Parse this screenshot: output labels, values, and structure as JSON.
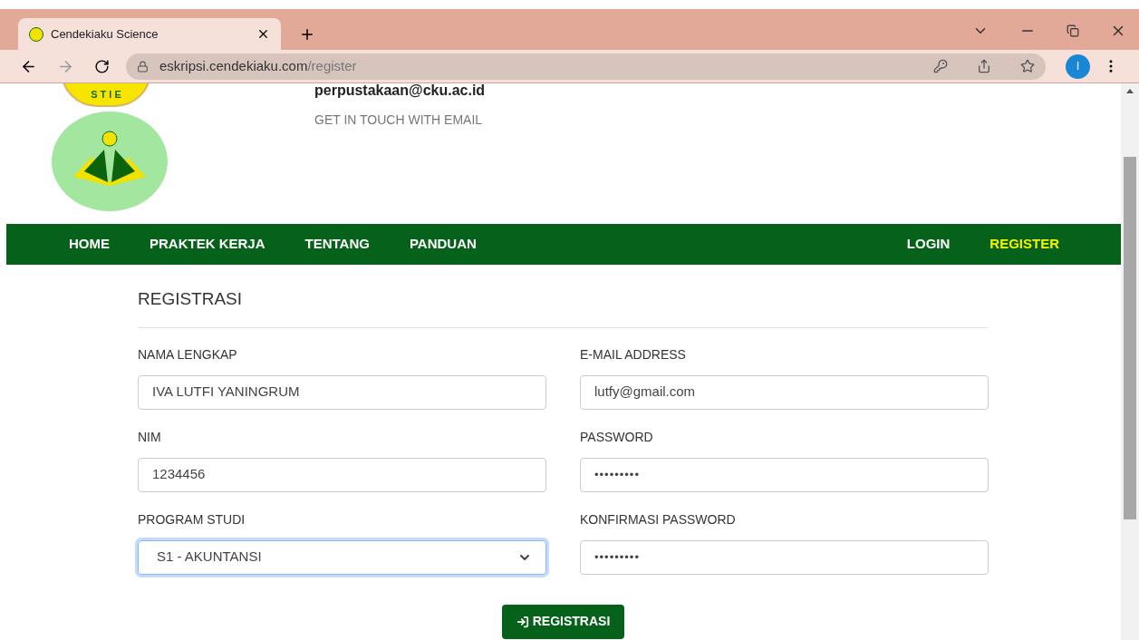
{
  "browser": {
    "tab_title": "Cendekiaku Science",
    "url_host": "eskripsi.cendekiaku.com",
    "url_path": "/register",
    "profile_initial": "I"
  },
  "header": {
    "logo_top_text": "S T I E",
    "email": "perpustakaan@cku.ac.id",
    "email_caption": "GET IN TOUCH WITH EMAIL"
  },
  "nav": {
    "left": [
      {
        "label": "HOME",
        "selected": false
      },
      {
        "label": "PRAKTEK KERJA",
        "selected": false
      },
      {
        "label": "TENTANG",
        "selected": false
      },
      {
        "label": "PANDUAN",
        "selected": false
      }
    ],
    "right": [
      {
        "label": "LOGIN",
        "selected": false
      },
      {
        "label": "REGISTER",
        "selected": true
      }
    ]
  },
  "form": {
    "title": "REGISTRASI",
    "fields": [
      {
        "label": "NAMA LENGKAP",
        "kind": "text",
        "value": "IVA LUTFI YANINGRUM",
        "focused": false
      },
      {
        "label": "E-MAIL ADDRESS",
        "kind": "text",
        "value": "lutfy@gmail.com",
        "focused": false
      },
      {
        "label": "NIM",
        "kind": "text",
        "value": "1234456",
        "focused": false
      },
      {
        "label": "PASSWORD",
        "kind": "password",
        "value": "•••••••••",
        "focused": false
      },
      {
        "label": "PROGRAM STUDI",
        "kind": "select",
        "value": "S1 - AKUNTANSI",
        "focused": true
      },
      {
        "label": "KONFIRMASI PASSWORD",
        "kind": "password",
        "value": "•••••••••",
        "focused": false
      }
    ],
    "submit": "REGISTRASI"
  }
}
